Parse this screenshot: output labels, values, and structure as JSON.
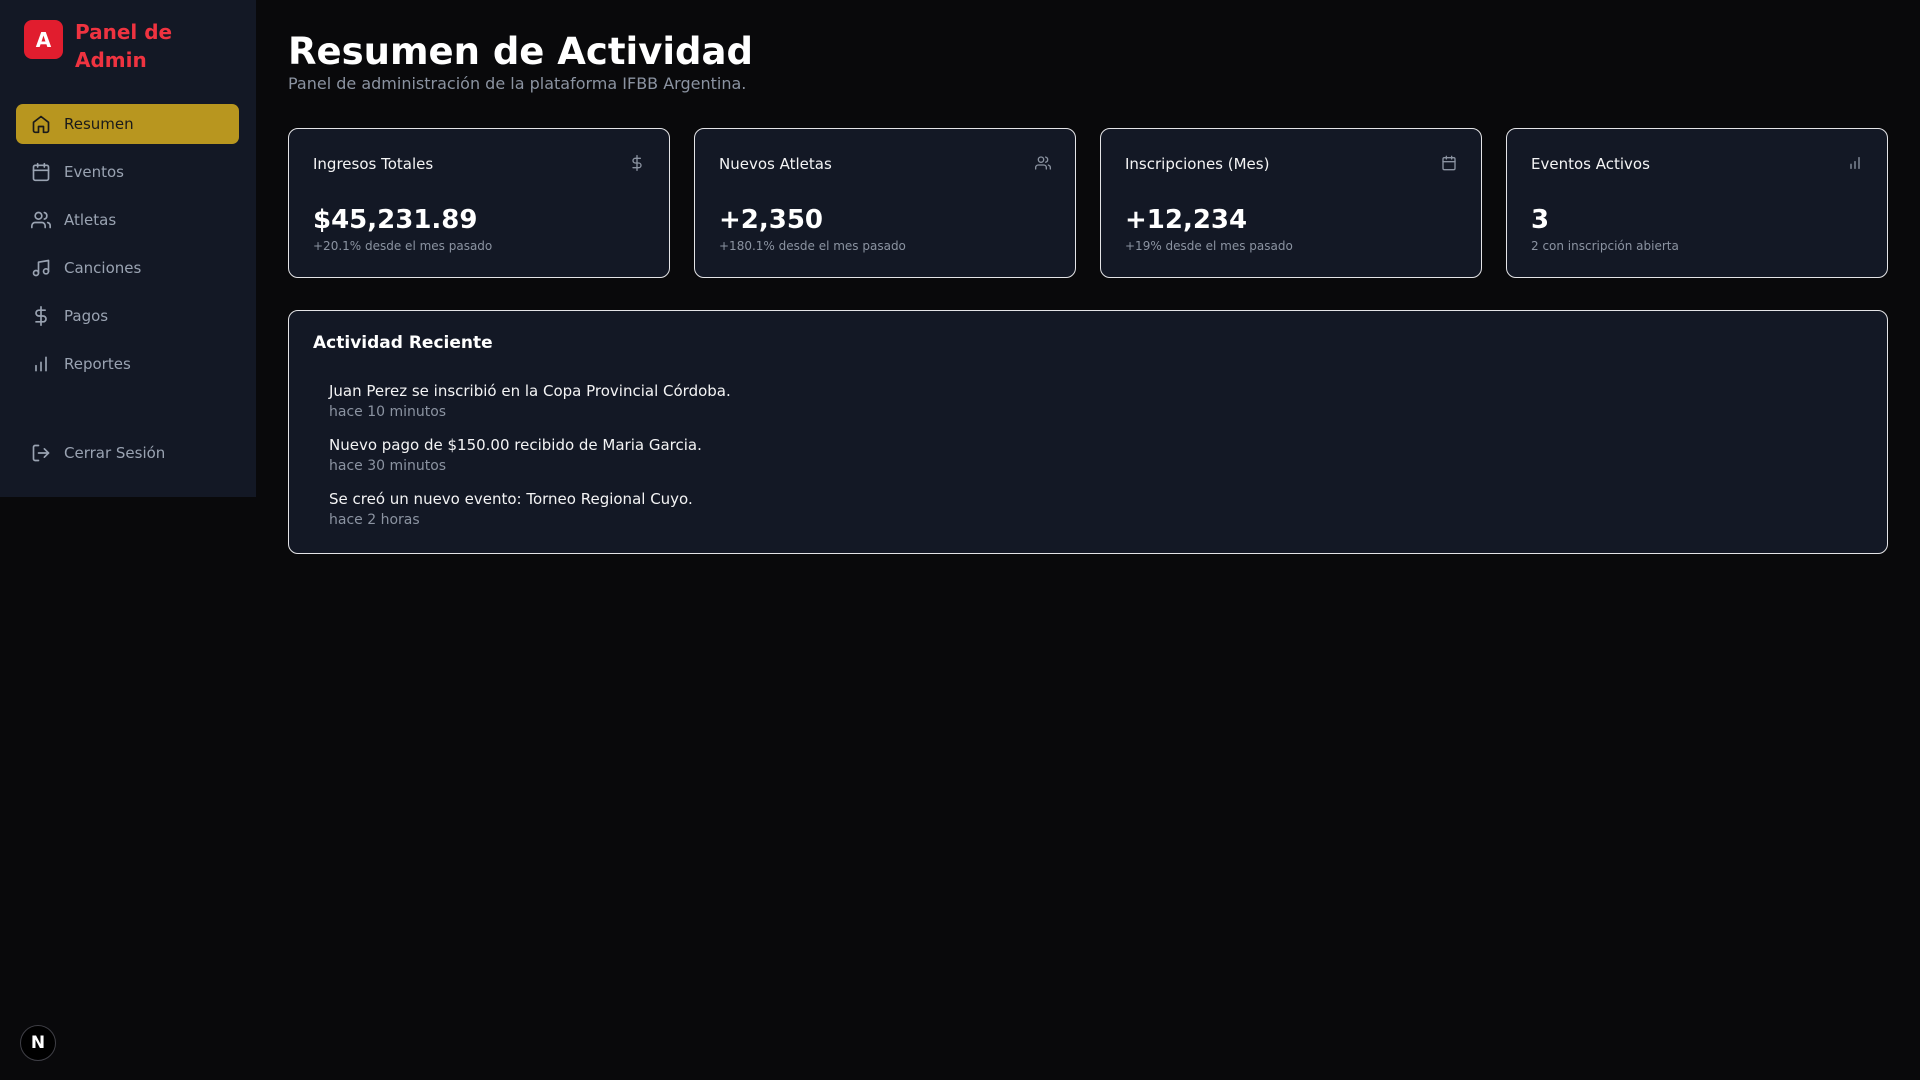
{
  "sidebar": {
    "brand_logo": "A",
    "brand_title": "Panel de Admin",
    "items": [
      {
        "label": "Resumen",
        "icon": "home-icon",
        "active": true
      },
      {
        "label": "Eventos",
        "icon": "calendar-icon",
        "active": false
      },
      {
        "label": "Atletas",
        "icon": "users-icon",
        "active": false
      },
      {
        "label": "Canciones",
        "icon": "music-icon",
        "active": false
      },
      {
        "label": "Pagos",
        "icon": "dollar-icon",
        "active": false
      },
      {
        "label": "Reportes",
        "icon": "bar-chart-icon",
        "active": false
      }
    ],
    "logout_label": "Cerrar Sesión"
  },
  "header": {
    "title": "Resumen de Actividad",
    "subtitle": "Panel de administración de la plataforma IFBB Argentina."
  },
  "stats": [
    {
      "label": "Ingresos Totales",
      "value": "$45,231.89",
      "note": "+20.1% desde el mes pasado",
      "icon": "dollar-icon"
    },
    {
      "label": "Nuevos Atletas",
      "value": "+2,350",
      "note": "+180.1% desde el mes pasado",
      "icon": "users-icon"
    },
    {
      "label": "Inscripciones (Mes)",
      "value": "+12,234",
      "note": "+19% desde el mes pasado",
      "icon": "calendar-icon"
    },
    {
      "label": "Eventos Activos",
      "value": "3",
      "note": "2 con inscripción abierta",
      "icon": "bar-chart-icon"
    }
  ],
  "activity": {
    "title": "Actividad Reciente",
    "items": [
      {
        "text": "Juan Perez se inscribió en la Copa Provincial Córdoba.",
        "time": "hace 10 minutos"
      },
      {
        "text": "Nuevo pago de $150.00 recibido de Maria Garcia.",
        "time": "hace 30 minutos"
      },
      {
        "text": "Se creó un nuevo evento: Torneo Regional Cuyo.",
        "time": "hace 2 horas"
      }
    ]
  },
  "dev_badge": "N",
  "colors": {
    "background": "#09090b",
    "panel": "#131825",
    "accent_active": "#b8961f",
    "brand_red": "#e11d2e"
  }
}
